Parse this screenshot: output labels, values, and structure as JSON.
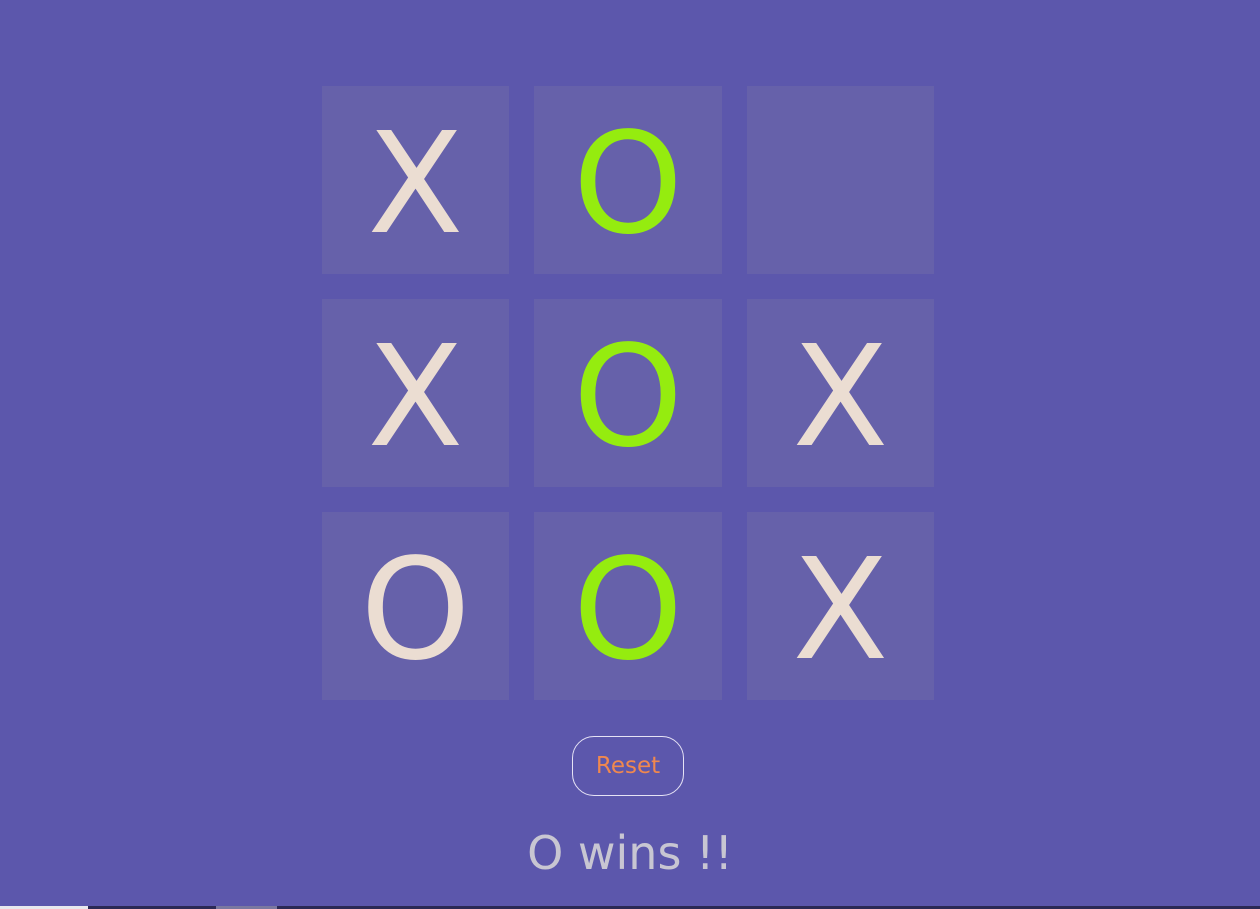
{
  "board": {
    "cells": [
      {
        "mark": "X",
        "win": false
      },
      {
        "mark": "O",
        "win": true
      },
      {
        "mark": "",
        "win": false
      },
      {
        "mark": "X",
        "win": false
      },
      {
        "mark": "O",
        "win": true
      },
      {
        "mark": "X",
        "win": false
      },
      {
        "mark": "O",
        "win": false
      },
      {
        "mark": "O",
        "win": true
      },
      {
        "mark": "X",
        "win": false
      }
    ]
  },
  "controls": {
    "reset_label": "Reset"
  },
  "status": {
    "text": "O wins !!"
  },
  "colors": {
    "background": "#5c57ac",
    "cell": "#6661aa",
    "mark": "#ebddd2",
    "winning_mark": "#95ec0f",
    "reset_text": "#f0884e",
    "status_text": "#c8c6d2"
  }
}
